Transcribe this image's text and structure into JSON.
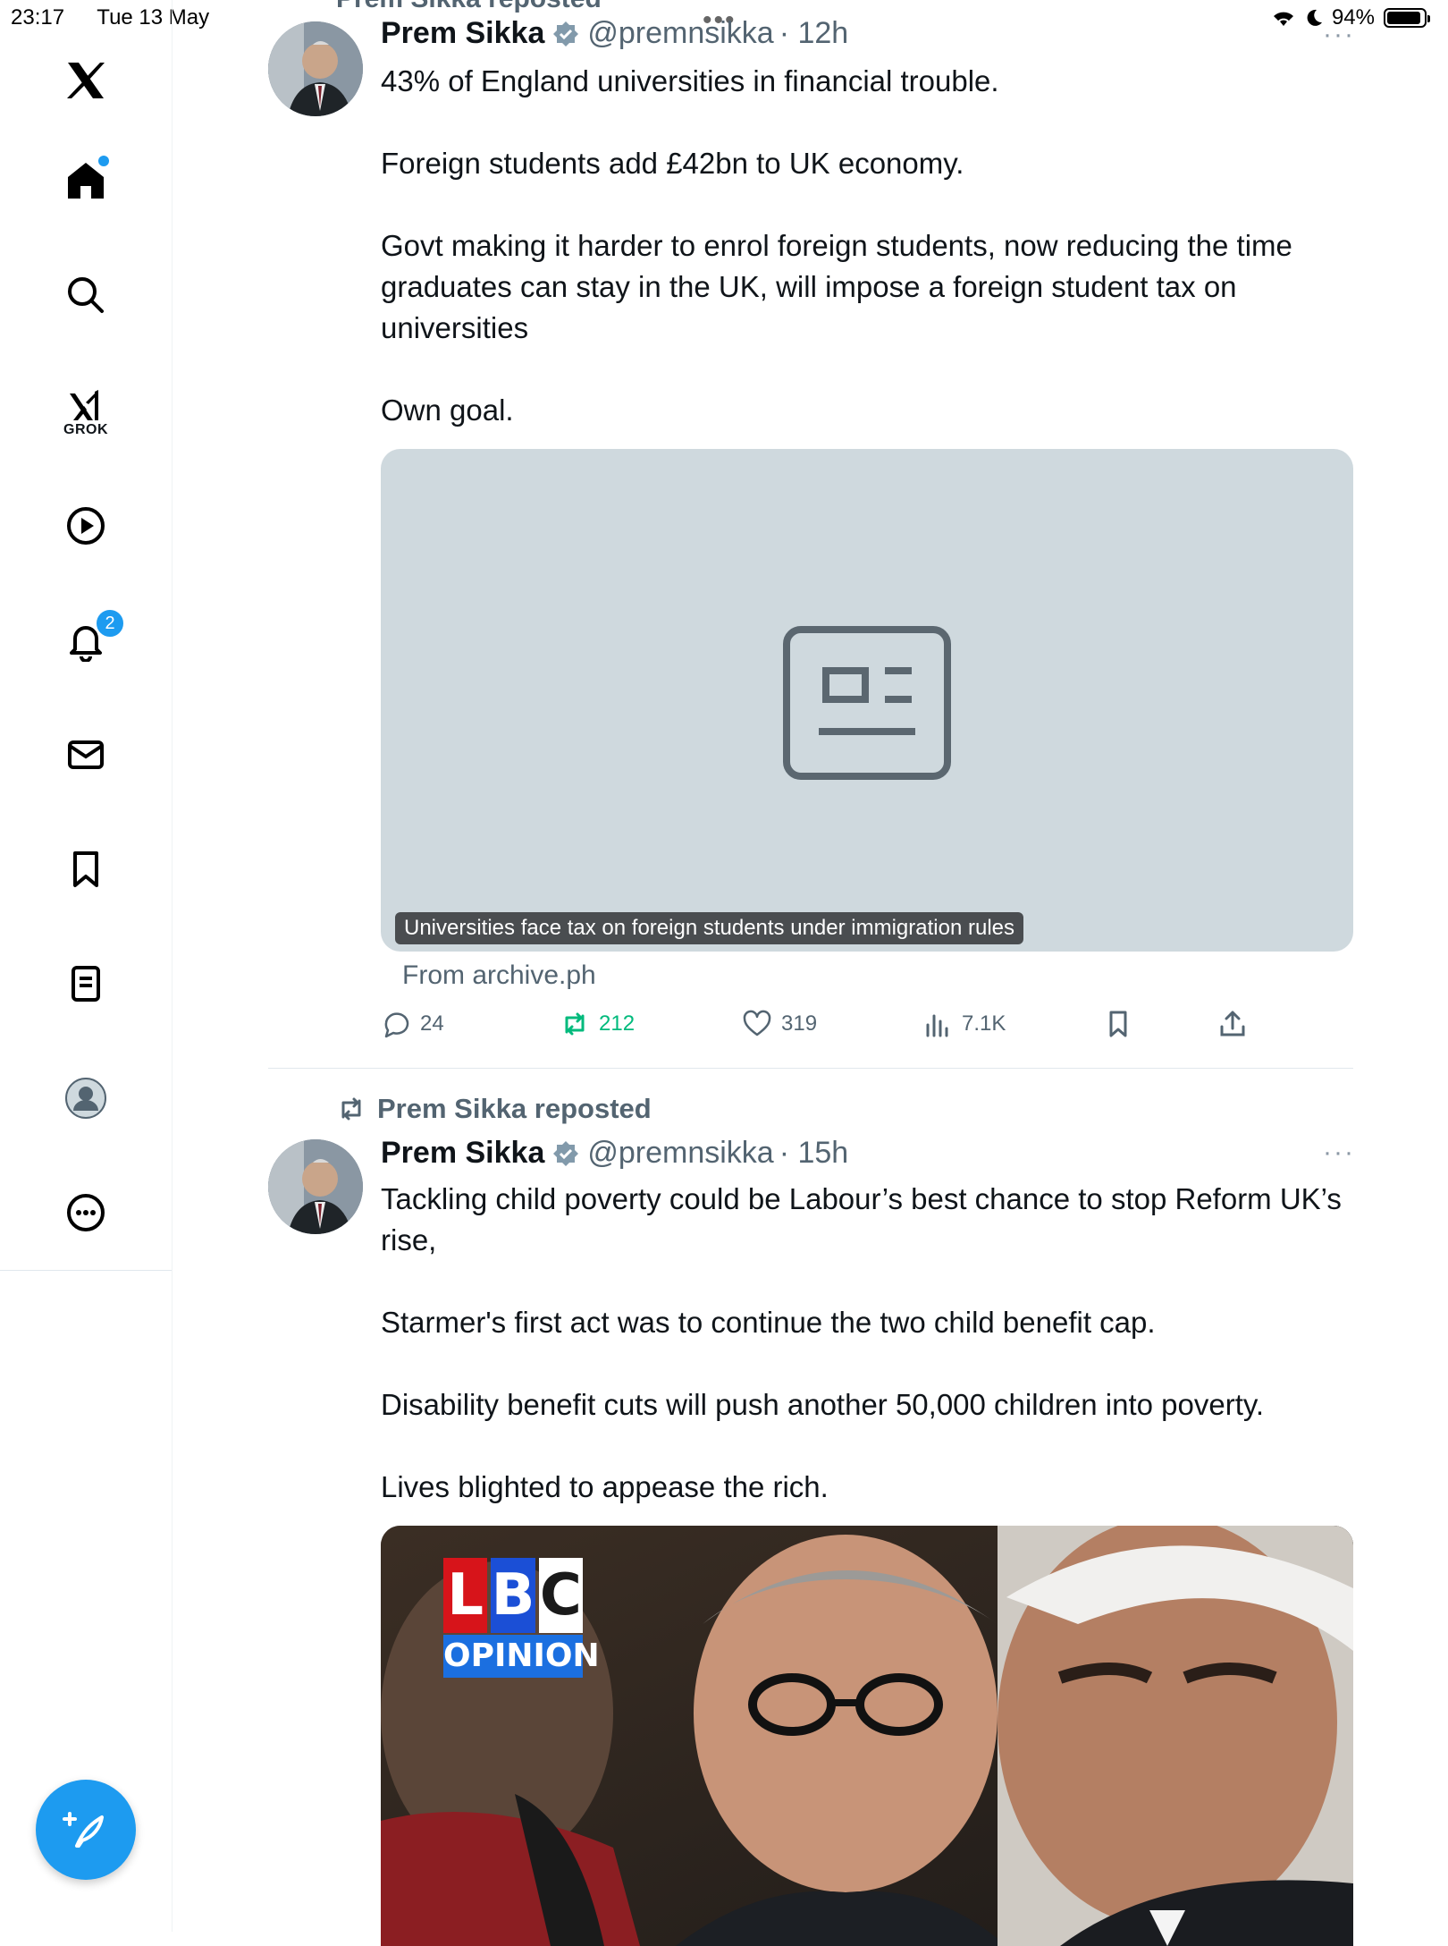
{
  "status_bar": {
    "time": "23:17",
    "date": "Tue 13 May",
    "battery": "94%",
    "battery_level": 0.94
  },
  "sidebar": {
    "items": [
      {
        "name": "home",
        "label": "Home"
      },
      {
        "name": "explore",
        "label": "Explore"
      },
      {
        "name": "grok",
        "label": "GROK"
      },
      {
        "name": "videos",
        "label": "Videos"
      },
      {
        "name": "notifications",
        "label": "Notifications",
        "badge": "2"
      },
      {
        "name": "messages",
        "label": "Messages"
      },
      {
        "name": "bookmarks",
        "label": "Bookmarks"
      },
      {
        "name": "lists",
        "label": "Lists"
      },
      {
        "name": "profile",
        "label": "Profile"
      },
      {
        "name": "more",
        "label": "More"
      }
    ]
  },
  "top_repost_label": "Prem Sikka reposted",
  "tweets": [
    {
      "name": "Prem Sikka",
      "handle": "@premnsikka",
      "time": "· 12h",
      "paragraphs": [
        "43% of England universities in financial trouble.",
        "Foreign students add £42bn to UK economy.",
        "Govt making it harder to enrol foreign students, now reducing the time graduates can stay in the UK, will impose a foreign student tax on universities",
        "Own goal."
      ],
      "card": {
        "caption": "Universities face tax on foreign students under immigration rules",
        "source": "From archive.ph"
      },
      "actions": {
        "replies": "24",
        "reposts": "212",
        "likes": "319",
        "views": "7.1K"
      }
    },
    {
      "repost_label": "Prem Sikka reposted",
      "name": "Prem Sikka",
      "handle": "@premnsikka",
      "time": "· 15h",
      "paragraphs": [
        "Tackling child poverty could be Labour’s best chance to stop Reform UK’s rise,",
        "Starmer's first act was to continue the two child benefit cap.",
        "Disability benefit cuts will push another 50,000 children into poverty.",
        "Lives blighted to appease the rich."
      ],
      "image": {
        "logo_top": "LBC",
        "logo_bottom": "OPINION"
      }
    }
  ],
  "colors": {
    "accent": "#1d9bf0",
    "repost_green": "#00ba7c",
    "muted": "#536471",
    "card_bg": "#cfd9de"
  }
}
